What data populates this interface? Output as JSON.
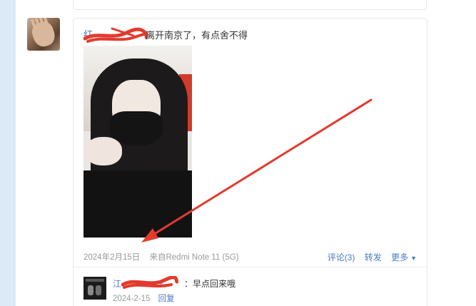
{
  "post": {
    "author_visible": "红",
    "text": "离开南京了，有点舍不得",
    "date": "2024年2月15日",
    "source": "来自Redmi Note 11 (5G)"
  },
  "actions": {
    "comment": "评论(3)",
    "repost": "转发",
    "more": "更多",
    "more_icon": "caret-down"
  },
  "comment": {
    "author_visible": "江",
    "author_visible_tail": "人",
    "separator": "：",
    "text": "早点回来哦",
    "date": "2024-2-15",
    "reply": "回复"
  },
  "colors": {
    "link": "#4a7bc8",
    "annotation_red": "#e23b2e",
    "left_strip": "#dce9f6"
  }
}
